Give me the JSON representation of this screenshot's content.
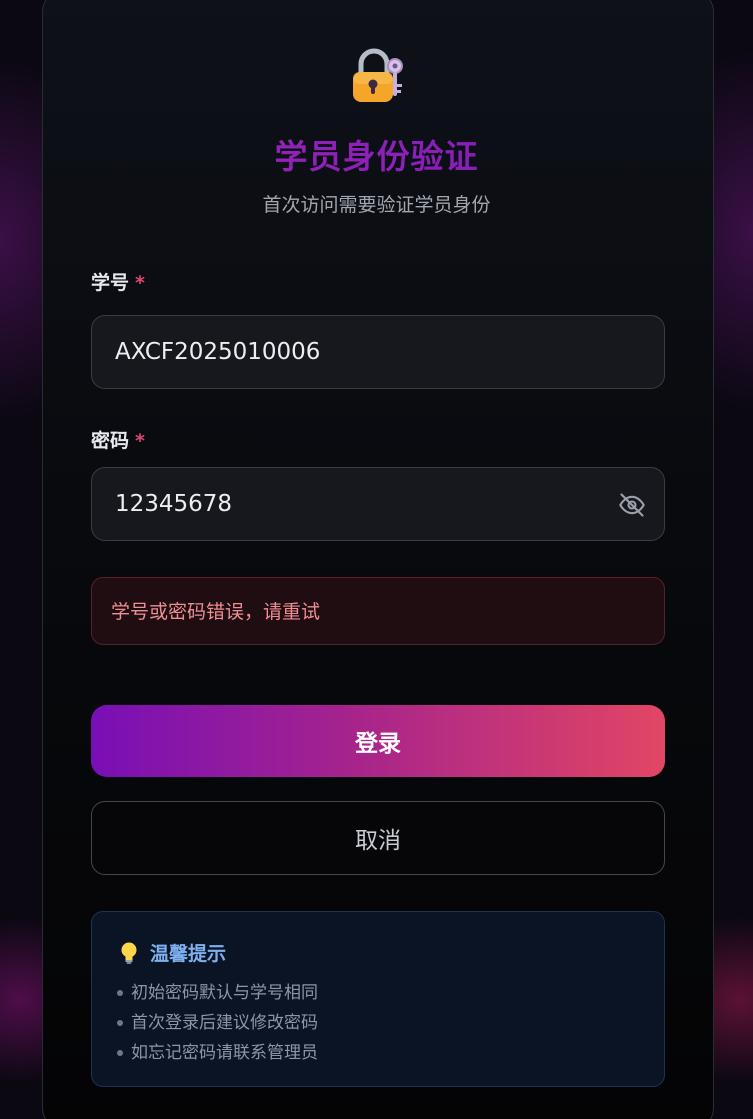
{
  "header": {
    "title": "学员身份验证",
    "subtitle": "首次访问需要验证学员身份"
  },
  "form": {
    "student_id_label": "学号",
    "student_id_value": "AXCF2025010006",
    "password_label": "密码",
    "password_value": "12345678",
    "required_mark": "*",
    "error_message": "学号或密码错误，请重试"
  },
  "buttons": {
    "login_label": "登录",
    "cancel_label": "取消"
  },
  "tips": {
    "title": "温馨提示",
    "items": [
      "初始密码默认与学号相同",
      "首次登录后建议修改密码",
      "如忘记密码请联系管理员"
    ]
  },
  "icons": {
    "header": "lock-with-key-icon",
    "password_toggle": "eye-off-icon",
    "tips": "light-bulb-icon"
  },
  "colors": {
    "accent_start": "#780fb6",
    "accent_end": "#e24664",
    "error_text": "#ee8e95",
    "tips_title": "#7fb0f0"
  }
}
